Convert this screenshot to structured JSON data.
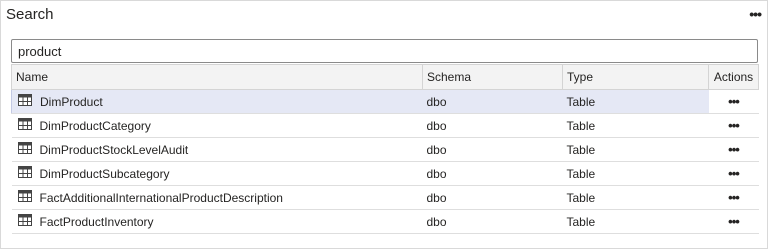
{
  "panel": {
    "title": "Search"
  },
  "search": {
    "value": "product",
    "placeholder": ""
  },
  "table": {
    "headers": {
      "name": "Name",
      "schema": "Schema",
      "type": "Type",
      "actions": "Actions"
    },
    "rows": [
      {
        "name": "DimProduct",
        "schema": "dbo",
        "type": "Table"
      },
      {
        "name": "DimProductCategory",
        "schema": "dbo",
        "type": "Table"
      },
      {
        "name": "DimProductStockLevelAudit",
        "schema": "dbo",
        "type": "Table"
      },
      {
        "name": "DimProductSubcategory",
        "schema": "dbo",
        "type": "Table"
      },
      {
        "name": "FactAdditionalInternationalProductDescription",
        "schema": "dbo",
        "type": "Table"
      },
      {
        "name": "FactProductInventory",
        "schema": "dbo",
        "type": "Table"
      }
    ]
  },
  "icons": {
    "row_icon": "table-grid-icon",
    "actions_icon": "more-horizontal-icon"
  },
  "colors": {
    "selected_row": "#e5e8f5",
    "header_bg": "#f3f3f3"
  }
}
